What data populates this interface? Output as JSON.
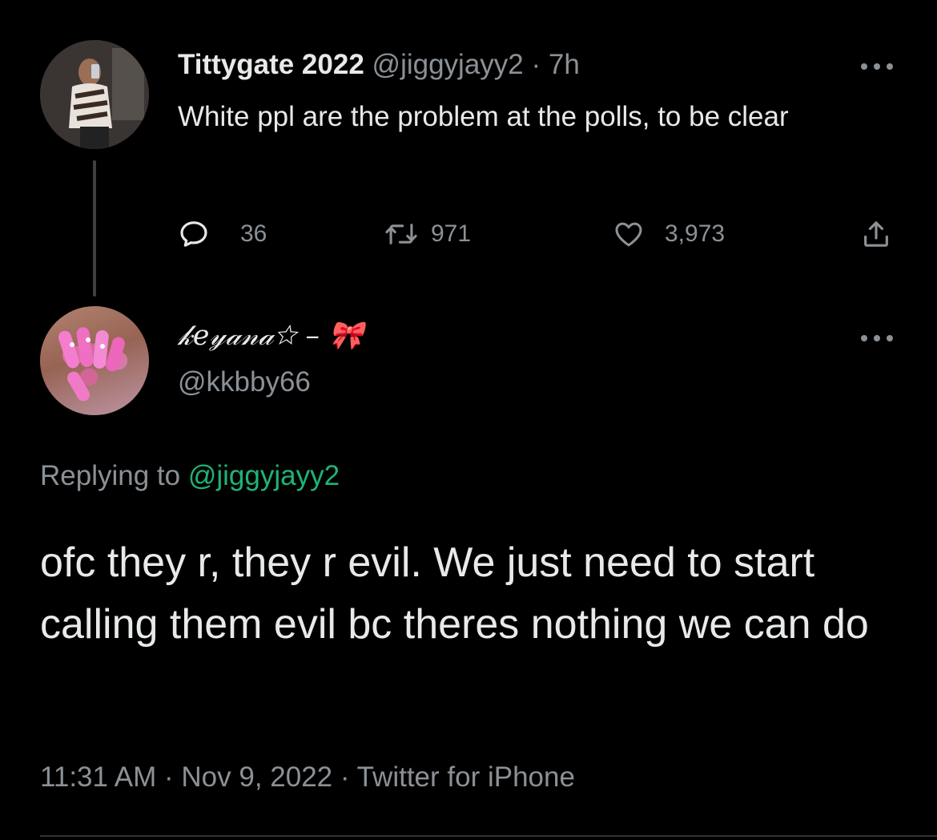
{
  "parent_tweet": {
    "display_name": "Tittygate 2022",
    "handle": "@jiggyjayy2",
    "separator": " · ",
    "time_ago": "7h",
    "text": "White ppl are the problem at the polls, to be clear",
    "replies": "36",
    "retweets": "971",
    "likes": "3,973",
    "icons": [
      "reply-icon",
      "retweet-icon",
      "like-icon",
      "share-icon",
      "more-icon"
    ]
  },
  "reply_tweet": {
    "display_name": "𝓀𝑒𝓎𝒶𝓃𝒶☆ – 🎀",
    "handle": "@kkbby66",
    "replying_prefix": "Replying to ",
    "replying_to": "@jiggyjayy2",
    "text": "ofc they r, they r evil. We just need to start calling them evil bc theres nothing we can do",
    "timestamp": "11:31 AM · Nov 9, 2022 · Twitter for iPhone"
  },
  "colors": {
    "background": "#000000",
    "primary_text": "#e7e9ea",
    "secondary_text": "#8b9196",
    "mention": "#1fb377",
    "thread_line": "#3e4144"
  }
}
